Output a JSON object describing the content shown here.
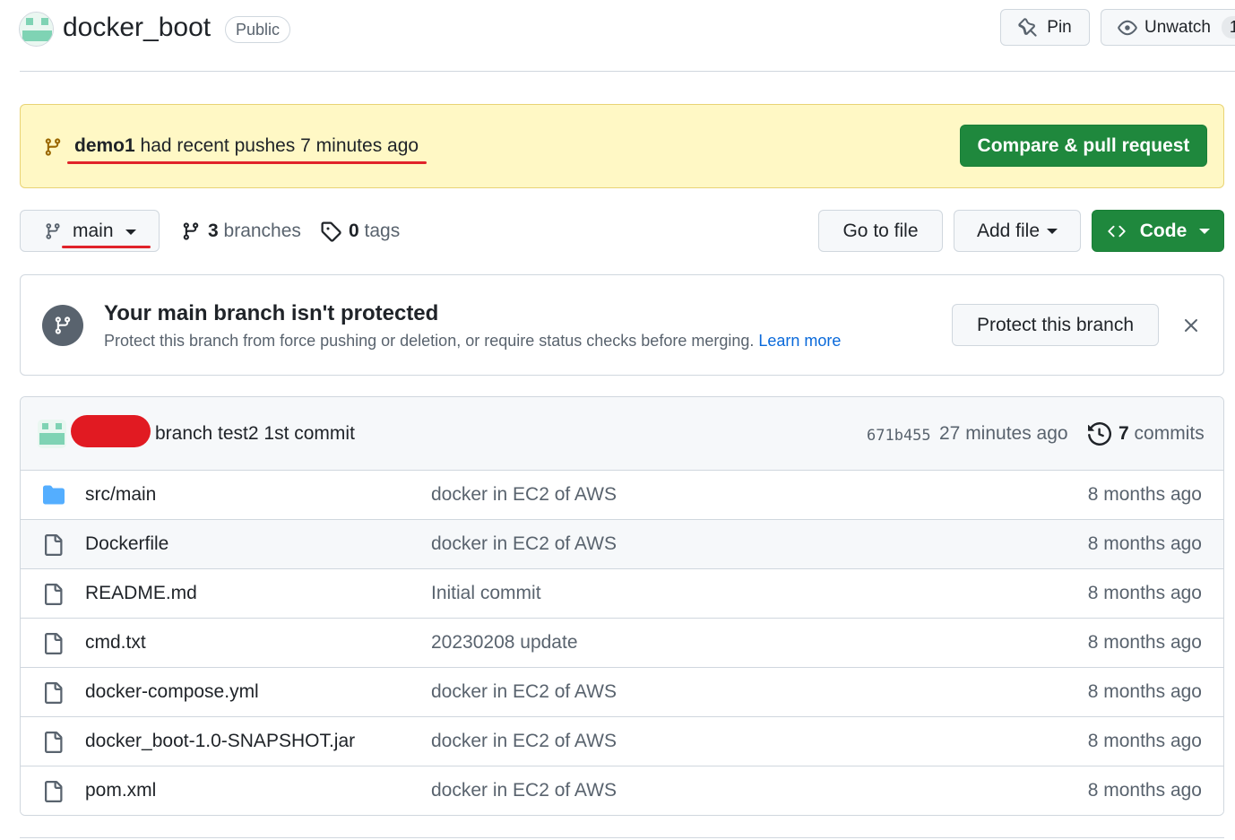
{
  "repo": {
    "name": "docker_boot",
    "visibility": "Public"
  },
  "header_actions": {
    "pin_label": "Pin",
    "unwatch_label": "Unwatch",
    "unwatch_count": "1"
  },
  "push_banner": {
    "branch": "demo1",
    "message": " had recent pushes 7 minutes ago",
    "button_label": "Compare & pull request"
  },
  "toolbar": {
    "current_branch": "main",
    "branches_count": "3",
    "branches_label": "branches",
    "tags_count": "0",
    "tags_label": "tags",
    "go_to_file_label": "Go to file",
    "add_file_label": "Add file",
    "code_label": "Code"
  },
  "protection_notice": {
    "title": "Your main branch isn't protected",
    "description": "Protect this branch from force pushing or deletion, or require status checks before merging. ",
    "learn_more": "Learn more",
    "button_label": "Protect this branch"
  },
  "latest_commit": {
    "message": "branch test2 1st commit",
    "sha": "671b455",
    "time": "27 minutes ago",
    "commits_count": "7",
    "commits_label": "commits"
  },
  "files": [
    {
      "name": "src/main",
      "type": "folder",
      "message": "docker in EC2 of AWS",
      "age": "8 months ago"
    },
    {
      "name": "Dockerfile",
      "type": "file",
      "message": "docker in EC2 of AWS",
      "age": "8 months ago"
    },
    {
      "name": "README.md",
      "type": "file",
      "message": "Initial commit",
      "age": "8 months ago"
    },
    {
      "name": "cmd.txt",
      "type": "file",
      "message": "20230208 update",
      "age": "8 months ago"
    },
    {
      "name": "docker-compose.yml",
      "type": "file",
      "message": "docker in EC2 of AWS",
      "age": "8 months ago"
    },
    {
      "name": "docker_boot-1.0-SNAPSHOT.jar",
      "type": "file",
      "message": "docker in EC2 of AWS",
      "age": "8 months ago"
    },
    {
      "name": "pom.xml",
      "type": "file",
      "message": "docker in EC2 of AWS",
      "age": "8 months ago"
    }
  ],
  "colors": {
    "accent_green": "#1f883d",
    "banner_yellow": "#fff8c5",
    "annotation_red": "#e0232a",
    "link_blue": "#0969da",
    "folder_blue": "#54aeff"
  }
}
